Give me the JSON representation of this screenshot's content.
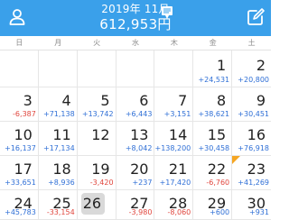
{
  "header": {
    "month_title": "2019年 11月",
    "total_amount": "612,953円",
    "left_icon": "person-icon",
    "right_icon": "edit-icon",
    "chat_icon": "chat-icon",
    "bg_color": "#3aa0ea"
  },
  "weekdays": [
    "日",
    "月",
    "火",
    "水",
    "木",
    "金",
    "土"
  ],
  "colors": {
    "positive": "#2f6fd6",
    "negative": "#e0463d",
    "today_bg": "#d9d9d9",
    "flag": "#f5a623"
  },
  "weeks": [
    [
      {
        "day": "",
        "amount": ""
      },
      {
        "day": "",
        "amount": ""
      },
      {
        "day": "",
        "amount": ""
      },
      {
        "day": "",
        "amount": ""
      },
      {
        "day": "",
        "amount": ""
      },
      {
        "day": "1",
        "amount": "+24,531"
      },
      {
        "day": "2",
        "amount": "+20,800"
      }
    ],
    [
      {
        "day": "3",
        "amount": "-6,387"
      },
      {
        "day": "4",
        "amount": "+71,138"
      },
      {
        "day": "5",
        "amount": "+13,742"
      },
      {
        "day": "6",
        "amount": "+6,443"
      },
      {
        "day": "7",
        "amount": "+3,151"
      },
      {
        "day": "8",
        "amount": "+38,621"
      },
      {
        "day": "9",
        "amount": "+30,451"
      }
    ],
    [
      {
        "day": "10",
        "amount": "+16,137"
      },
      {
        "day": "11",
        "amount": "+17,134"
      },
      {
        "day": "12",
        "amount": ""
      },
      {
        "day": "13",
        "amount": "+8,042"
      },
      {
        "day": "14",
        "amount": "+138,200"
      },
      {
        "day": "15",
        "amount": "+30,458"
      },
      {
        "day": "16",
        "amount": "+76,918"
      }
    ],
    [
      {
        "day": "17",
        "amount": "+33,651"
      },
      {
        "day": "18",
        "amount": "+8,936"
      },
      {
        "day": "19",
        "amount": "-3,420"
      },
      {
        "day": "20",
        "amount": "+237"
      },
      {
        "day": "21",
        "amount": "+17,420"
      },
      {
        "day": "22",
        "amount": "-6,760"
      },
      {
        "day": "23",
        "amount": "+41,269",
        "flag": true
      }
    ],
    [
      {
        "day": "24",
        "amount": "+45,783"
      },
      {
        "day": "25",
        "amount": "-33,154"
      },
      {
        "day": "26",
        "amount": "",
        "today": true
      },
      {
        "day": "27",
        "amount": "-3,980"
      },
      {
        "day": "28",
        "amount": "-8,060"
      },
      {
        "day": "29",
        "amount": "+600"
      },
      {
        "day": "30",
        "amount": "+931"
      }
    ]
  ]
}
